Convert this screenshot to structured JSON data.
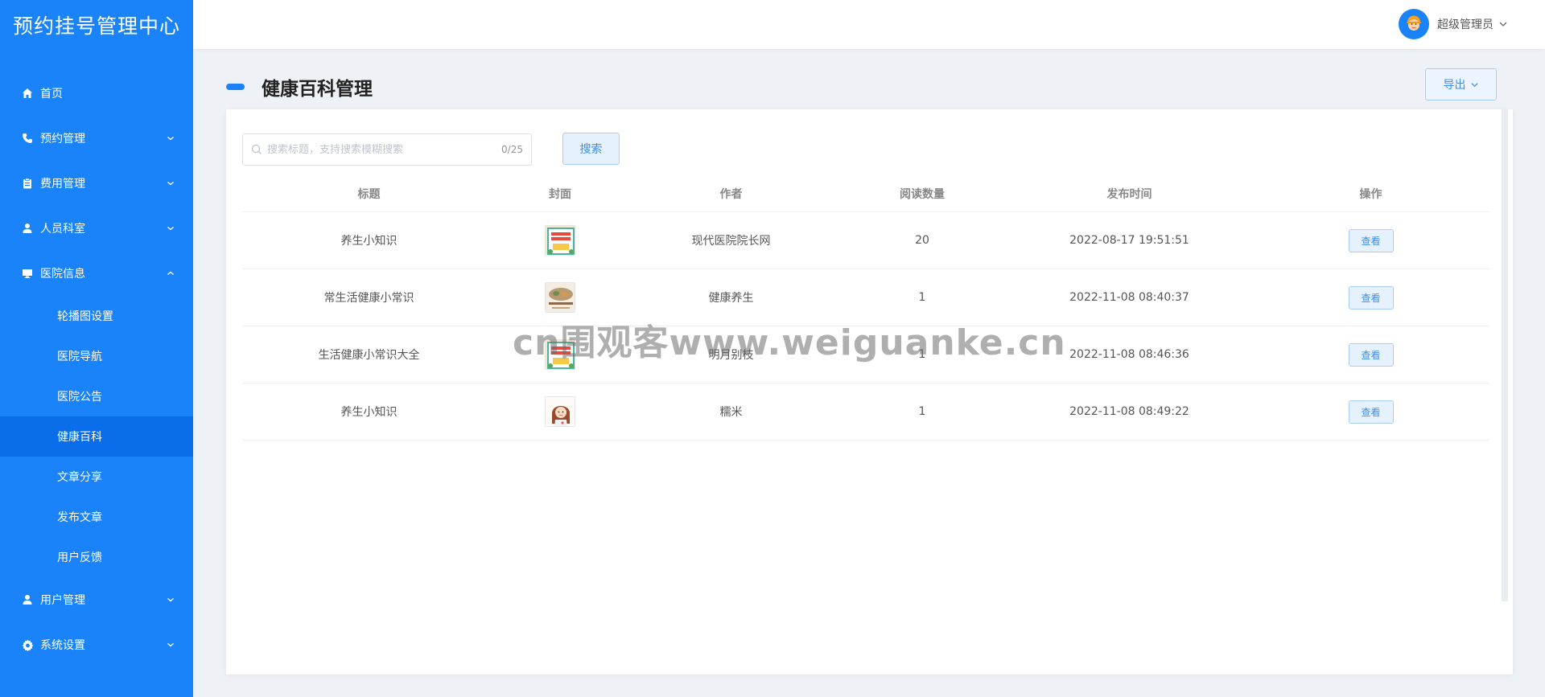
{
  "app": {
    "title": "预约挂号管理中心"
  },
  "sidebar": {
    "items": [
      {
        "label": "首页",
        "icon": "home-icon"
      },
      {
        "label": "预约管理",
        "icon": "phone-icon"
      },
      {
        "label": "费用管理",
        "icon": "clipboard-icon"
      },
      {
        "label": "人员科室",
        "icon": "user-icon"
      },
      {
        "label": "医院信息",
        "icon": "monitor-icon",
        "expanded": true
      },
      {
        "label": "用户管理",
        "icon": "user-icon"
      },
      {
        "label": "系统设置",
        "icon": "gear-icon"
      }
    ],
    "hospital_sub": [
      {
        "label": "轮播图设置"
      },
      {
        "label": "医院导航"
      },
      {
        "label": "医院公告"
      },
      {
        "label": "健康百科",
        "active": true
      },
      {
        "label": "文章分享"
      },
      {
        "label": "发布文章"
      },
      {
        "label": "用户反馈"
      }
    ]
  },
  "header": {
    "user_name": "超级管理员"
  },
  "page": {
    "title": "健康百科管理",
    "export_label": "导出"
  },
  "search": {
    "placeholder": "搜索标题，支持搜索模糊搜索",
    "counter": "0/25",
    "button_label": "搜索"
  },
  "table": {
    "columns": [
      "标题",
      "封面",
      "作者",
      "阅读数量",
      "发布时间",
      "操作"
    ],
    "rows": [
      {
        "title": "养生小知识",
        "author": "现代医院院长网",
        "reads": "20",
        "time": "2022-08-17 19:51:51",
        "action": "查看"
      },
      {
        "title": "常生活健康小常识",
        "author": "健康养生",
        "reads": "1",
        "time": "2022-11-08 08:40:37",
        "action": "查看"
      },
      {
        "title": "生活健康小常识大全",
        "author": "明月别枝",
        "reads": "1",
        "time": "2022-11-08 08:46:36",
        "action": "查看"
      },
      {
        "title": "养生小知识",
        "author": "糯米",
        "reads": "1",
        "time": "2022-11-08 08:49:22",
        "action": "查看"
      }
    ]
  },
  "watermark": "cn围观客www.weiguanke.cn",
  "colors": {
    "primary": "#1a83f9",
    "active_menu": "#0a6eea",
    "background": "#eef1f6"
  }
}
